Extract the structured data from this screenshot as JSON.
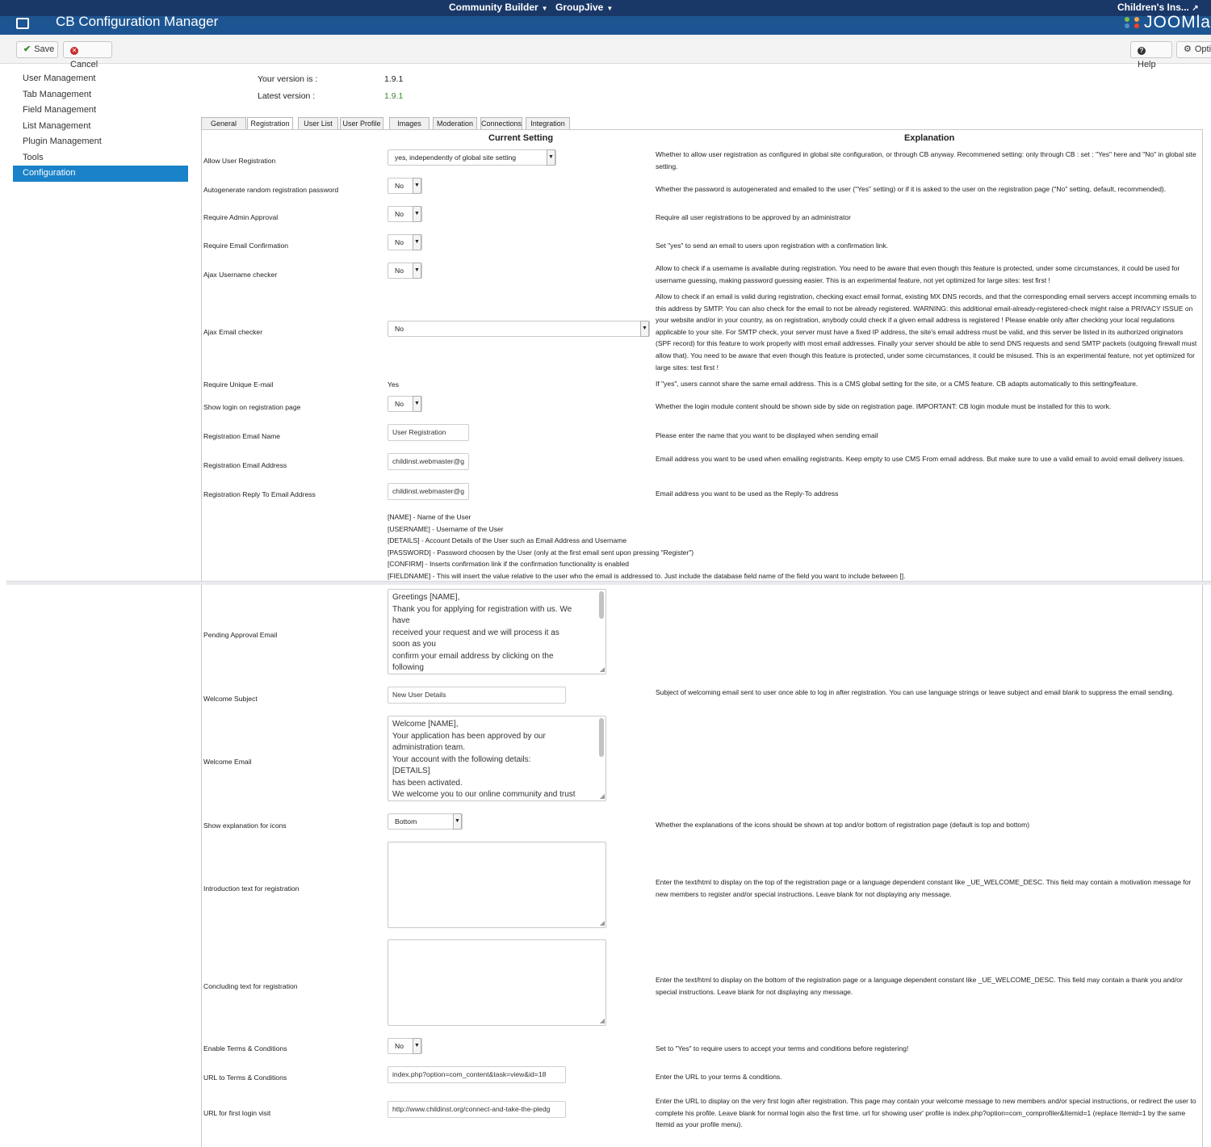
{
  "topnav": {
    "menu1": "Community Builder",
    "menu2": "GroupJive",
    "site_link": "Children's Ins..."
  },
  "titlebar": {
    "title": "CB Configuration Manager",
    "brand": "Joomla"
  },
  "toolbar": {
    "save": "Save",
    "cancel": "Cancel",
    "help": "Help",
    "options": "Options"
  },
  "sidebar": {
    "items": [
      {
        "label": "User Management"
      },
      {
        "label": "Tab Management"
      },
      {
        "label": "Field Management"
      },
      {
        "label": "List Management"
      },
      {
        "label": "Plugin Management"
      },
      {
        "label": "Tools"
      },
      {
        "label": "Configuration"
      }
    ],
    "active_index": 6
  },
  "version": {
    "your_label": "Your version is :",
    "your_value": "1.9.1",
    "latest_label": "Latest version :",
    "latest_value": "1.9.1"
  },
  "tabs": [
    "General",
    "Registration",
    "User List",
    "User Profile",
    "Images",
    "Moderation",
    "Connections",
    "Integration"
  ],
  "headers": {
    "current": "Current Setting",
    "explanation": "Explanation"
  },
  "rows": {
    "allow_reg": {
      "label": "Allow User Registration",
      "value": "yes, independently of global site setting",
      "exp": "Whether to allow user registration as configured in global site configuration, or through CB anyway. Recommened setting: only through CB : set : \"Yes\" here and \"No\" in global site setting."
    },
    "autogen": {
      "label": "Autogenerate random registration password",
      "value": "No",
      "exp": "Whether the password is autogenerated and emailed to the user (\"Yes\" setting) or if it is asked to the user on the registration page (\"No\" setting, default, recommended)."
    },
    "admin_approval": {
      "label": "Require Admin Approval",
      "value": "No",
      "exp": "Require all user registrations to be approved by an administrator"
    },
    "email_confirm": {
      "label": "Require Email Confirmation",
      "value": "No",
      "exp": "Set \"yes\" to send an email to users upon registration with a confirmation link."
    },
    "ajax_user": {
      "label": "Ajax Username checker",
      "value": "No",
      "exp": "Allow to check if a username is available during registration. You need to be aware that even though this feature is protected, under some circumstances, it could be used for username guessing, making password guessing easier. This is an experimental feature, not yet optimized for large sites: test first !"
    },
    "ajax_email": {
      "label": "Ajax Email checker",
      "value": "No",
      "exp": "Allow to check if an email is valid during registration, checking exact email format, existing MX DNS records, and that the corresponding email servers accept incomming emails to this address by SMTP. You can also check for the email to not be already registered. WARNING: this additional email-already-registered-check might raise a PRIVACY ISSUE on your website and/or in your country, as on registration, anybody could check if a given email address is registered ! Please enable only after checking your local regulations applicable to your site. For SMTP check, your server must have a fixed IP address, the site's email address must be valid, and this server be listed in its authorized originators (SPF record) for this feature to work properly with most email addresses. Finally your server should be able to send DNS requests and send SMTP packets (outgoing firewall must allow that). You need to be aware that even though this feature is protected, under some circumstances, it could be misused. This is an experimental feature, not yet optimized for large sites: test first !"
    },
    "unique_email": {
      "label": "Require Unique E-mail",
      "value": "Yes",
      "exp": "If \"yes\", users cannot share the same email address. This is a CMS global setting for the site, or a CMS feature. CB adapts automatically to this setting/feature."
    },
    "show_login": {
      "label": "Show login on registration page",
      "value": "No",
      "exp": "Whether the login module content should be shown side by side on registration page. IMPORTANT: CB login module must be installed for this to work."
    },
    "email_name": {
      "label": "Registration Email Name",
      "value": "User Registration",
      "exp": "Please enter the name that you want to be displayed when sending email"
    },
    "email_addr": {
      "label": "Registration Email Address",
      "value": "childinst.webmaster@g",
      "exp": "Email address you want to be used when emailing registrants. Keep empty to use CMS From email address. But make sure to use a valid email to avoid email delivery issues."
    },
    "reply_to": {
      "label": "Registration Reply To Email Address",
      "value": "childinst.webmaster@g",
      "exp": "Email address you want to be used as the Reply-To address"
    },
    "pending": {
      "label": "Pending Approval Email",
      "lines": [
        "Greetings [NAME],",
        "Thank you for applying for registration with us. We",
        "have",
        "received your request and we will process it as",
        "soon as you",
        "confirm your email address by clicking on the",
        "following"
      ]
    },
    "welcome_subject": {
      "label": "Welcome Subject",
      "value": "New User Details",
      "exp": "Subject of welcoming email sent to user once able to log in after registration. You can use language strings or leave subject and email blank to suppress the email sending."
    },
    "welcome_email": {
      "label": "Welcome Email",
      "lines": [
        "Welcome [NAME],",
        "Your application has been approved by our",
        "administration team.",
        "Your account with the following details:",
        "[DETAILS]",
        "has been activated.",
        "We welcome you to our online community and trust"
      ]
    },
    "icons_expl": {
      "label": "Show explanation for icons",
      "value": "Bottom",
      "exp": "Whether the explanations of the icons should be shown at top and/or bottom of registration page (default is top and bottom)"
    },
    "intro": {
      "label": "Introduction text for registration",
      "exp": "Enter the text/html to display on the top of the registration page or a language dependent constant like _UE_WELCOME_DESC. This field may contain a motivation message for new members to register and/or special instructions. Leave blank for not displaying any message."
    },
    "concluding": {
      "label": "Concluding text for registration",
      "exp": "Enter the text/html to display on the bottom of the registration page or a language dependent constant like _UE_WELCOME_DESC. This field may contain a thank you and/or special instructions. Leave blank for not displaying any message."
    },
    "terms": {
      "label": "Enable Terms & Conditions",
      "value": "No",
      "exp": "Set to \"Yes\" to require users to accept your terms and conditions before registering!"
    },
    "terms_url": {
      "label": "URL to Terms & Conditions",
      "value": "index.php?option=com_content&task=view&id=18",
      "exp": "Enter the URL to your terms & conditions."
    },
    "first_login": {
      "label": "URL for first login visit",
      "value": "http://www.childinst.org/connect-and-take-the-pledg",
      "exp": "Enter the URL to display on the very first login after registration. This page may contain your welcome message to new members and/or special instructions, or redirect the user to complete his profile. Leave blank for normal login also the first time. url for showing user' profile is index.php?option=com_comprofiler&Itemid=1 (replace Itemid=1 by the same Itemid as your profile menu)."
    }
  },
  "placeholders": [
    "[NAME] - Name of the User",
    "[USERNAME] - Username of the User",
    "[DETAILS] - Account Details of the User such as Email Address and Username",
    "[PASSWORD] - Password choosen by the User (only at the first email sent upon pressing \"Register\")",
    "[CONFIRM] - Inserts confirmation link if the confirmation functionality is enabled",
    "[FIELDNAME] - This will insert the value relative to the user who the email is addressed to. Just include the database field name of the field you want to include between []."
  ]
}
